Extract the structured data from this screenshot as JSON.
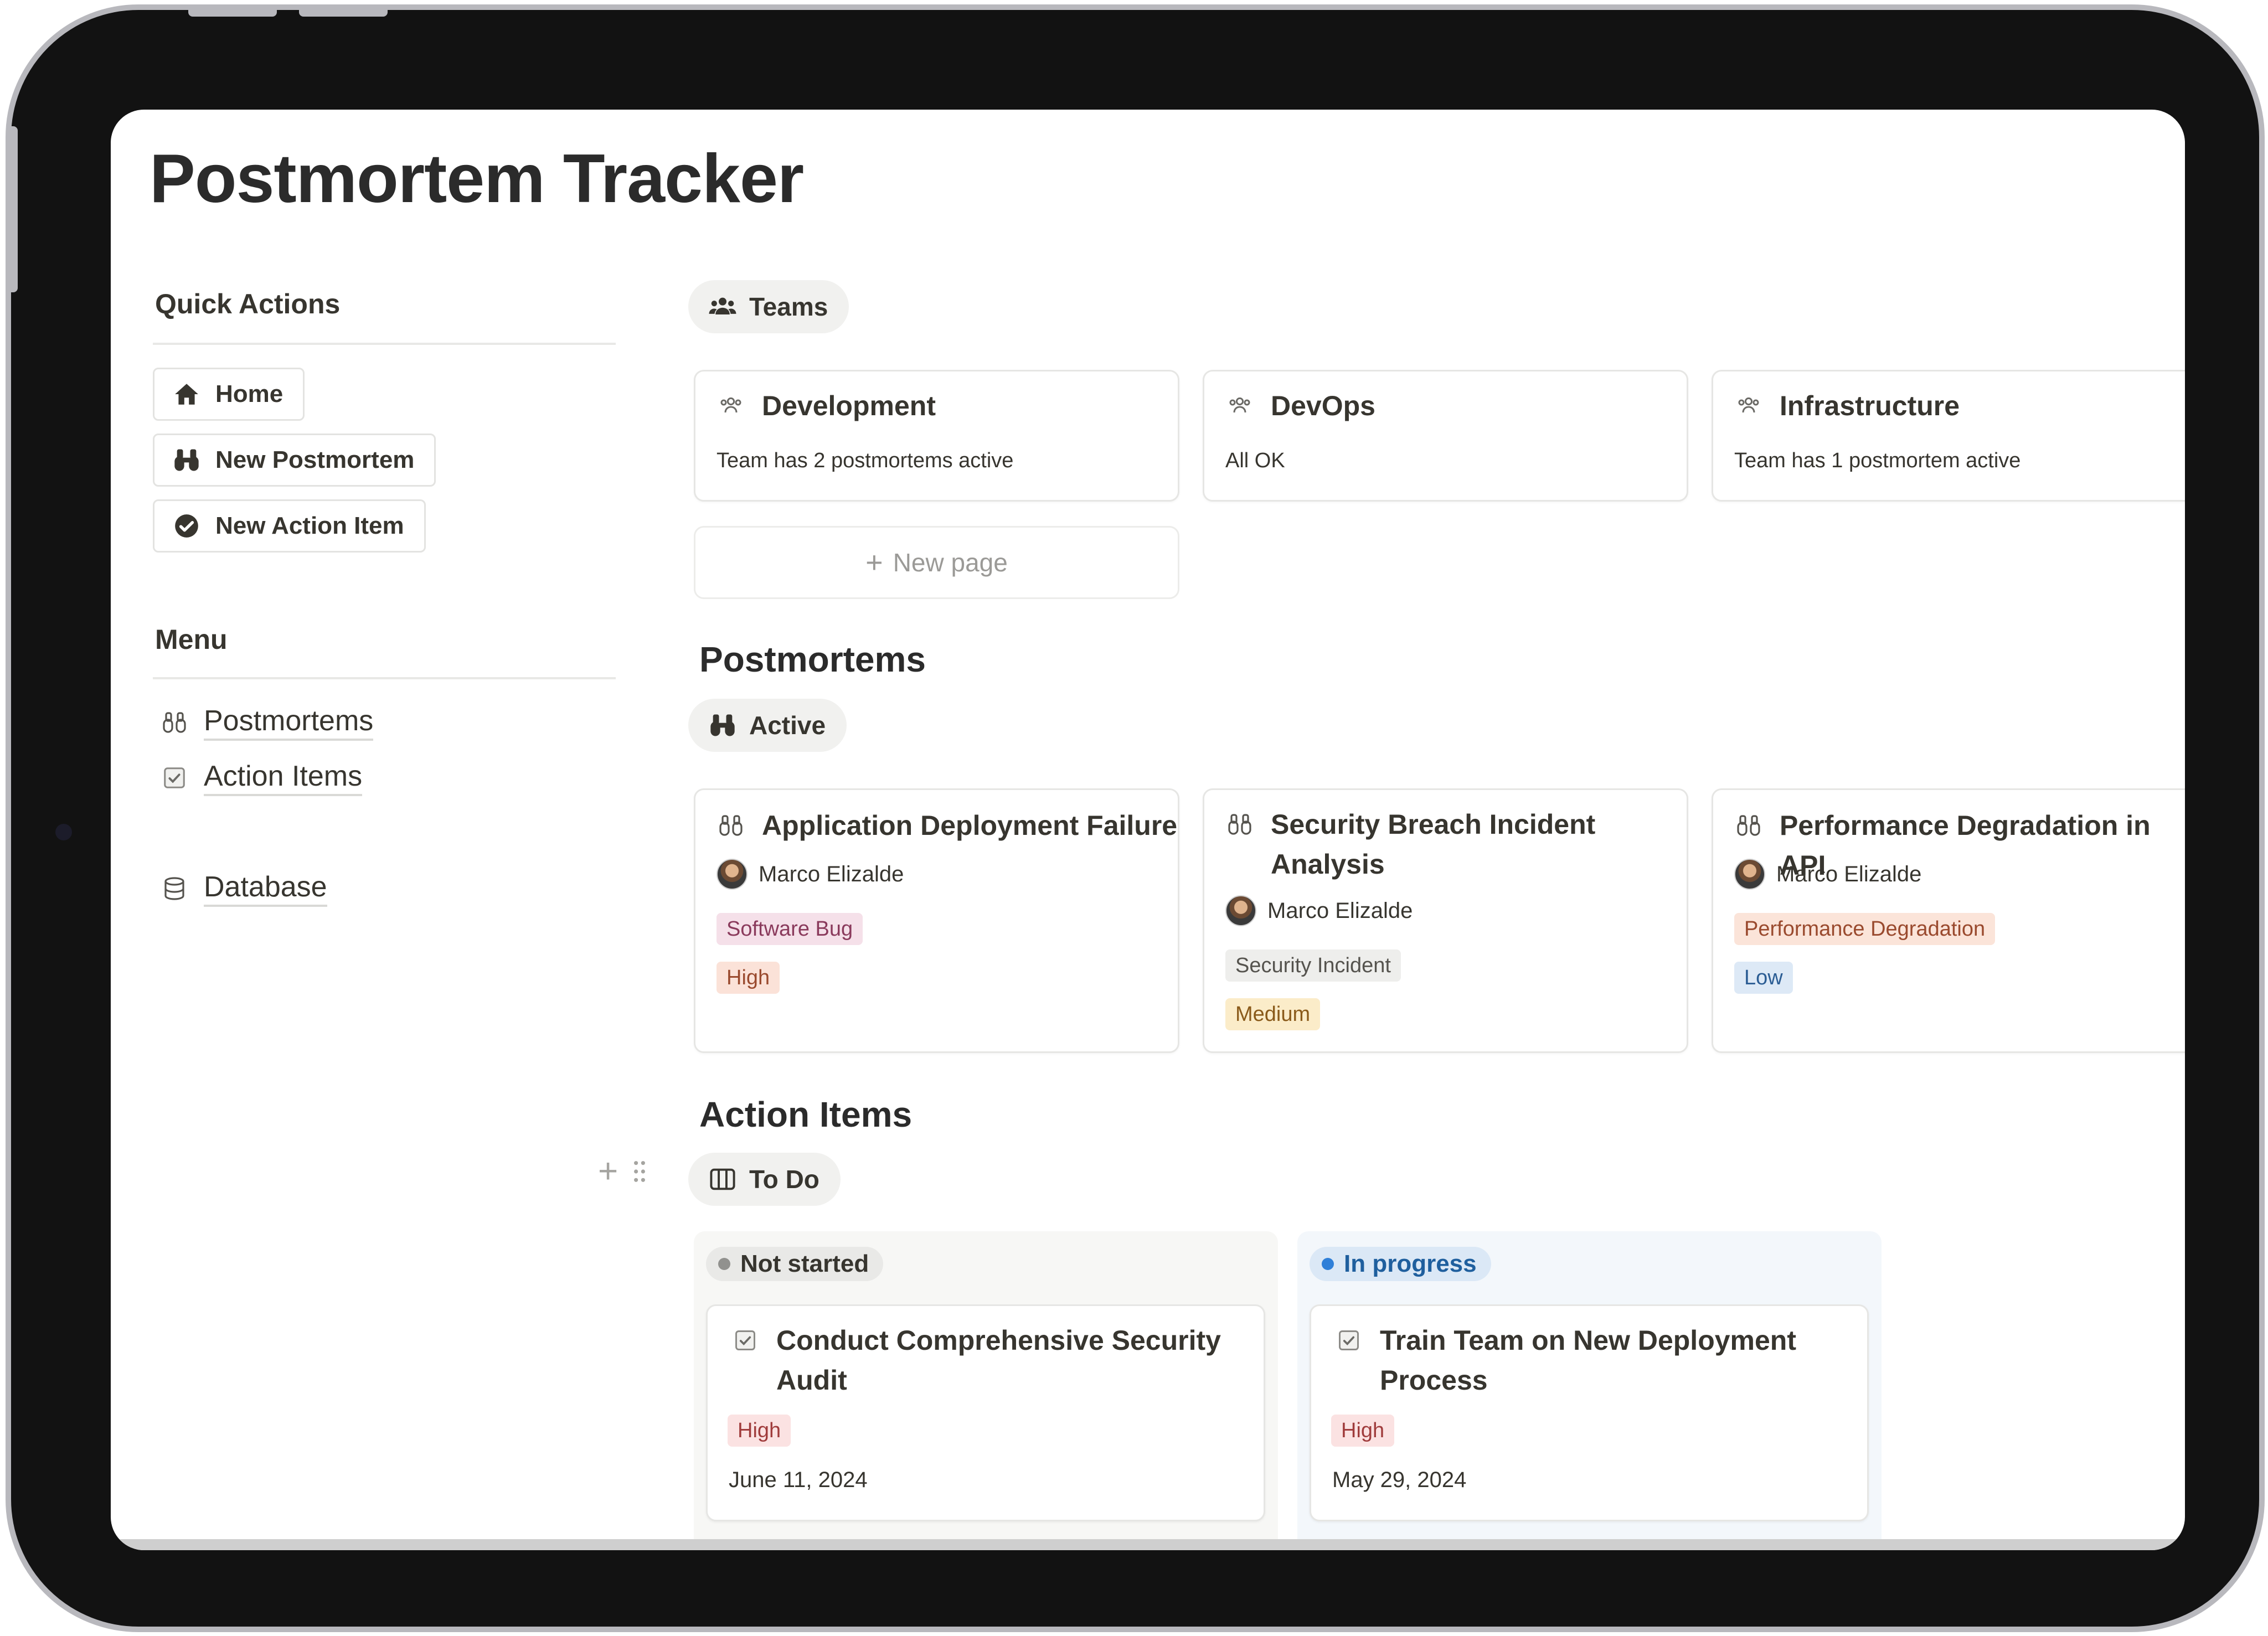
{
  "page": {
    "title": "Postmortem Tracker"
  },
  "sidebar": {
    "quick_actions": {
      "heading": "Quick Actions",
      "buttons": [
        {
          "label": "Home",
          "icon": "home-icon"
        },
        {
          "label": "New Postmortem",
          "icon": "binoculars-icon"
        },
        {
          "label": "New Action Item",
          "icon": "check-circle-icon"
        }
      ]
    },
    "menu": {
      "heading": "Menu",
      "links": [
        {
          "label": "Postmortems",
          "icon": "binoculars-icon"
        },
        {
          "label": "Action Items",
          "icon": "checkbox-icon"
        },
        {
          "label": "Database",
          "icon": "database-icon"
        }
      ]
    }
  },
  "teams": {
    "view_label": "Teams",
    "cards": [
      {
        "name": "Development",
        "status": "Team has 2 postmortems active"
      },
      {
        "name": "DevOps",
        "status": "All OK"
      },
      {
        "name": "Infrastructure",
        "status": "Team has 1 postmortem active"
      }
    ],
    "new_page_label": "New page"
  },
  "postmortems": {
    "heading": "Postmortems",
    "view_label": "Active",
    "cards": [
      {
        "title": "Application Deployment Failure",
        "owner": "Marco Elizalde",
        "category": "Software Bug",
        "severity": "High"
      },
      {
        "title": "Security Breach Incident Analysis",
        "owner": "Marco Elizalde",
        "category": "Security Incident",
        "severity": "Medium"
      },
      {
        "title": "Performance Degradation in API",
        "owner": "Marco Elizalde",
        "category": "Performance Degradation",
        "severity": "Low"
      }
    ]
  },
  "action_items": {
    "heading": "Action Items",
    "view_label": "To Do",
    "columns": [
      {
        "status": "Not started",
        "cards": [
          {
            "title": "Conduct Comprehensive Security Audit",
            "priority": "High",
            "date": "June 11, 2024"
          }
        ]
      },
      {
        "status": "In progress",
        "cards": [
          {
            "title": "Train Team on New Deployment Process",
            "priority": "High",
            "date": "May 29, 2024"
          }
        ]
      }
    ]
  },
  "colors": {
    "tag_software_bug_bg": "#f5e0e9",
    "tag_security_bg": "#eeeeec",
    "tag_performance_bg": "#fbe4d9",
    "tag_high_bg": "#fbe2d8",
    "tag_medium_bg": "#fbecc9",
    "tag_low_bg": "#dde9f6",
    "status_not_started_dot": "#91918e",
    "status_in_progress_dot": "#2f7fd8"
  }
}
